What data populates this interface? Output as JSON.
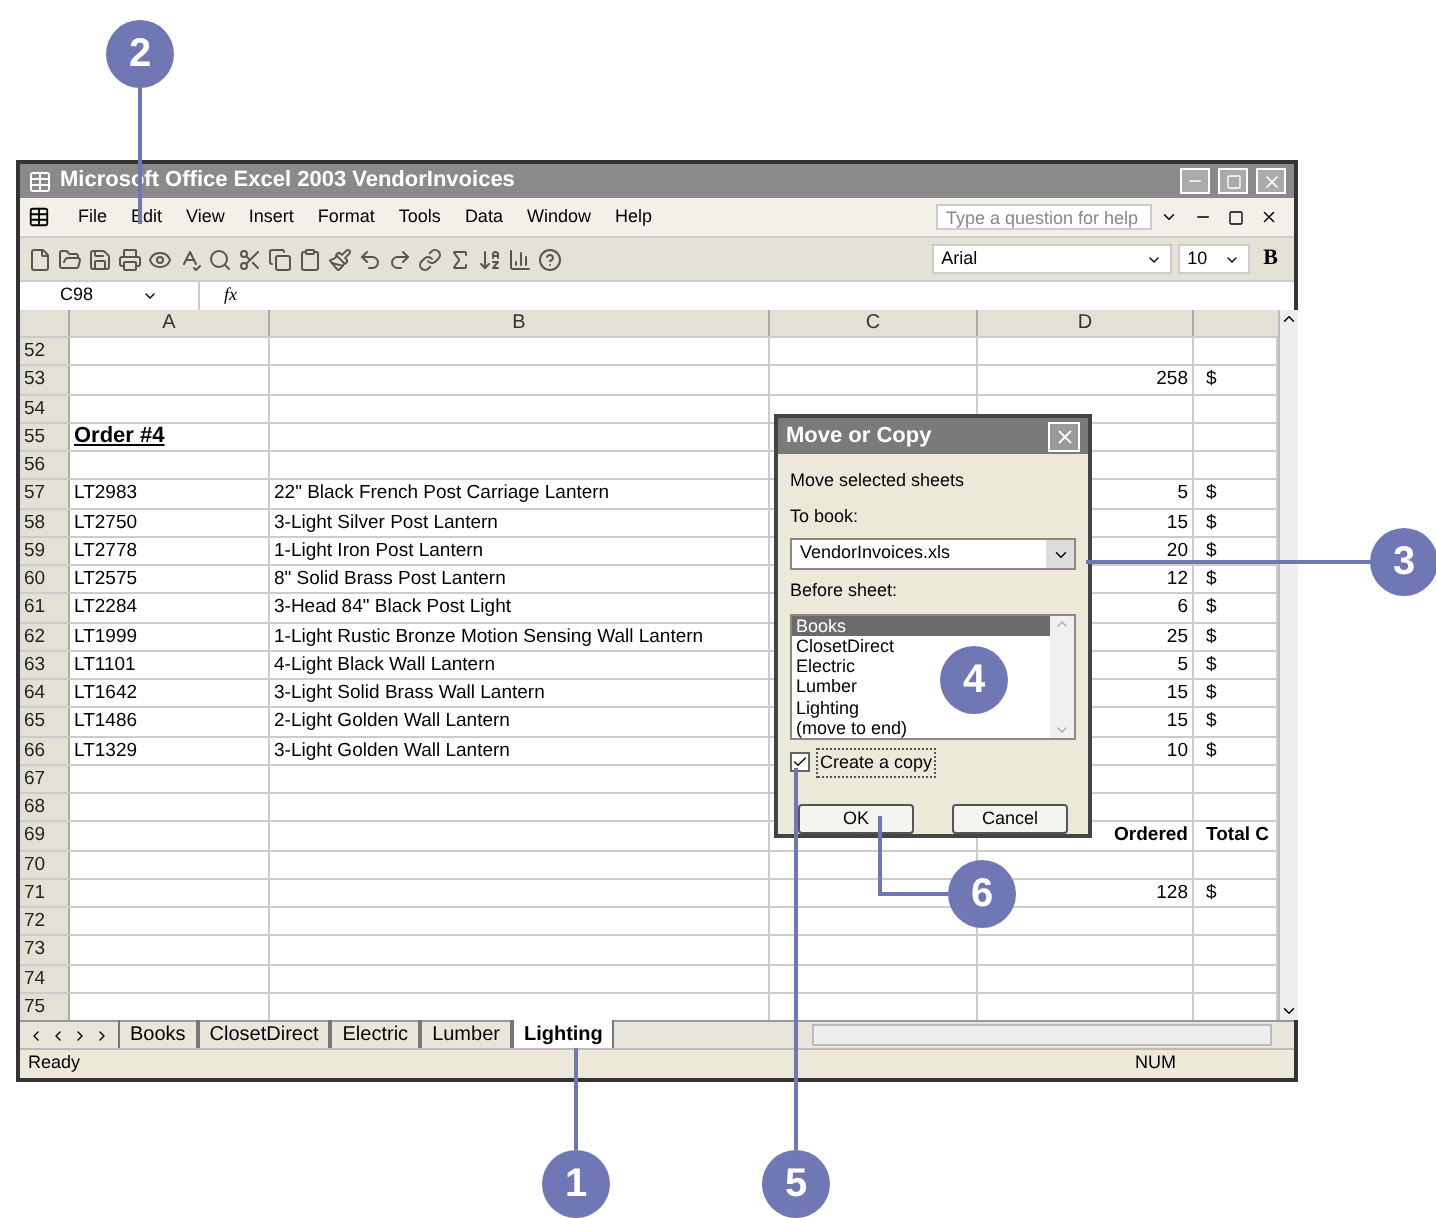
{
  "window": {
    "title": "Microsoft Office Excel 2003  VendorInvoices"
  },
  "menu": [
    "File",
    "Edit",
    "View",
    "Insert",
    "Format",
    "Tools",
    "Data",
    "Window",
    "Help"
  ],
  "help_box": {
    "placeholder": "Type a question for help"
  },
  "toolbar": {
    "font": "Arial",
    "size": "10",
    "bold": "B"
  },
  "formula_bar": {
    "name_box": "C98",
    "fx": "fx"
  },
  "columns": [
    "A",
    "B",
    "C",
    "D"
  ],
  "rows": [
    {
      "num": "52",
      "cells": [
        "",
        "",
        "",
        "",
        ""
      ]
    },
    {
      "num": "53",
      "cells": [
        "",
        "",
        "",
        "258",
        "$"
      ]
    },
    {
      "num": "54",
      "cells": [
        "",
        "",
        "",
        "",
        ""
      ]
    },
    {
      "num": "55",
      "cells": [
        "Order #4",
        "",
        "",
        "",
        ""
      ],
      "kind": "heading"
    },
    {
      "num": "56",
      "cells": [
        "",
        "",
        "",
        "",
        ""
      ]
    },
    {
      "num": "57",
      "cells": [
        "LT2983",
        "22\" Black French Post Carriage Lantern",
        "",
        "5",
        "$"
      ]
    },
    {
      "num": "58",
      "cells": [
        "LT2750",
        "3-Light Silver Post Lantern",
        "",
        "15",
        "$"
      ]
    },
    {
      "num": "59",
      "cells": [
        "LT2778",
        "1-Light Iron Post Lantern",
        "",
        "20",
        "$"
      ]
    },
    {
      "num": "60",
      "cells": [
        "LT2575",
        "8\" Solid Brass Post Lantern",
        "",
        "12",
        "$"
      ]
    },
    {
      "num": "61",
      "cells": [
        "LT2284",
        "3-Head 84\" Black Post Light",
        "",
        "6",
        "$"
      ]
    },
    {
      "num": "62",
      "cells": [
        "LT1999",
        "1-Light Rustic Bronze Motion Sensing Wall Lantern",
        "",
        "25",
        "$"
      ]
    },
    {
      "num": "63",
      "cells": [
        "LT1101",
        "4-Light Black Wall Lantern",
        "",
        "5",
        "$"
      ]
    },
    {
      "num": "64",
      "cells": [
        "LT1642",
        "3-Light Solid Brass Wall Lantern",
        "",
        "15",
        "$"
      ]
    },
    {
      "num": "65",
      "cells": [
        "LT1486",
        "2-Light Golden Wall Lantern",
        "",
        "15",
        "$"
      ]
    },
    {
      "num": "66",
      "cells": [
        "LT1329",
        "3-Light Golden Wall Lantern",
        "",
        "10",
        "$"
      ]
    },
    {
      "num": "67",
      "cells": [
        "",
        "",
        "",
        "",
        ""
      ]
    },
    {
      "num": "68",
      "cells": [
        "",
        "",
        "",
        "",
        ""
      ]
    },
    {
      "num": "69",
      "cells": [
        "",
        "",
        "",
        "Ordered",
        "Total C"
      ],
      "kind": "header"
    },
    {
      "num": "70",
      "cells": [
        "",
        "",
        "",
        "",
        ""
      ]
    },
    {
      "num": "71",
      "cells": [
        "",
        "",
        "",
        "128",
        "$"
      ]
    },
    {
      "num": "72",
      "cells": [
        "",
        "",
        "",
        "",
        ""
      ]
    },
    {
      "num": "73",
      "cells": [
        "",
        "",
        "",
        "",
        ""
      ]
    },
    {
      "num": "74",
      "cells": [
        "",
        "",
        "",
        "",
        ""
      ]
    },
    {
      "num": "75",
      "cells": [
        "",
        "",
        "",
        "",
        ""
      ]
    }
  ],
  "sheet_tabs": [
    {
      "label": "Books",
      "selected": false
    },
    {
      "label": "ClosetDirect",
      "selected": false
    },
    {
      "label": "Electric",
      "selected": false
    },
    {
      "label": "Lumber",
      "selected": false
    },
    {
      "label": "Lighting",
      "selected": true
    }
  ],
  "status_bar": {
    "text": "Ready",
    "num": "NUM"
  },
  "dialog": {
    "title": "Move or Copy",
    "intro": "Move selected sheets",
    "to_book_label": "To book:",
    "to_book_value": "VendorInvoices.xls",
    "before_label": "Before sheet:",
    "sheets": [
      {
        "label": "Books",
        "selected": true
      },
      {
        "label": "ClosetDirect",
        "selected": false
      },
      {
        "label": "Electric",
        "selected": false
      },
      {
        "label": "Lumber",
        "selected": false
      },
      {
        "label": "Lighting",
        "selected": false
      },
      {
        "label": "(move to end)",
        "selected": false
      }
    ],
    "create_copy": {
      "label": "Create a copy",
      "checked": true
    },
    "buttons": [
      "OK",
      "Cancel"
    ]
  },
  "callouts": [
    "2",
    "3",
    "4",
    "6",
    "1",
    "5"
  ]
}
